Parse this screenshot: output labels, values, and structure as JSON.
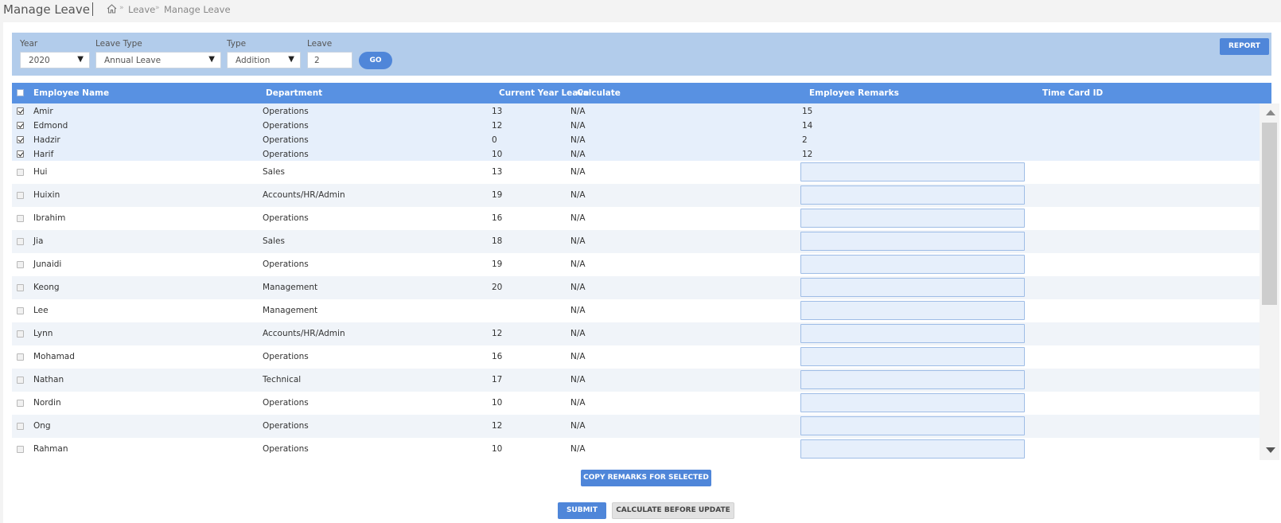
{
  "page": {
    "title": "Manage Leave"
  },
  "breadcrumb": {
    "home_icon": "home-icon",
    "items": [
      "Leave",
      "Manage Leave"
    ],
    "separator": "»"
  },
  "filters": {
    "year": {
      "label": "Year",
      "value": "2020"
    },
    "leave_type": {
      "label": "Leave Type",
      "value": "Annual Leave"
    },
    "type": {
      "label": "Type",
      "value": "Addition"
    },
    "leave": {
      "label": "Leave",
      "value": "2"
    },
    "go_label": "GO",
    "report_label": "REPORT"
  },
  "table": {
    "columns": [
      "Employee Name",
      "Department",
      "Current Year Leave",
      "Calculate",
      "Employee Remarks",
      "Time Card ID"
    ],
    "rows": [
      {
        "name": "Amir",
        "department": "Operations",
        "current_year_leave": "13",
        "calculate": "N/A",
        "remarks": "15",
        "checked": true
      },
      {
        "name": "Edmond",
        "department": "Operations",
        "current_year_leave": "12",
        "calculate": "N/A",
        "remarks": "14",
        "checked": true
      },
      {
        "name": "Hadzir",
        "department": "Operations",
        "current_year_leave": "0",
        "calculate": "N/A",
        "remarks": "2",
        "checked": true
      },
      {
        "name": "Harif",
        "department": "Operations",
        "current_year_leave": "10",
        "calculate": "N/A",
        "remarks": "12",
        "checked": true
      },
      {
        "name": "Hui",
        "department": "Sales",
        "current_year_leave": "13",
        "calculate": "N/A",
        "remarks": "",
        "checked": false
      },
      {
        "name": "Huixin",
        "department": "Accounts/HR/Admin",
        "current_year_leave": "19",
        "calculate": "N/A",
        "remarks": "",
        "checked": false
      },
      {
        "name": "Ibrahim",
        "department": "Operations",
        "current_year_leave": "16",
        "calculate": "N/A",
        "remarks": "",
        "checked": false
      },
      {
        "name": "Jia",
        "department": "Sales",
        "current_year_leave": "18",
        "calculate": "N/A",
        "remarks": "",
        "checked": false
      },
      {
        "name": "Junaidi",
        "department": "Operations",
        "current_year_leave": "19",
        "calculate": "N/A",
        "remarks": "",
        "checked": false
      },
      {
        "name": "Keong",
        "department": "Management",
        "current_year_leave": "20",
        "calculate": "N/A",
        "remarks": "",
        "checked": false
      },
      {
        "name": "Lee",
        "department": "Management",
        "current_year_leave": "",
        "calculate": "N/A",
        "remarks": "",
        "checked": false
      },
      {
        "name": "Lynn",
        "department": "Accounts/HR/Admin",
        "current_year_leave": "12",
        "calculate": "N/A",
        "remarks": "",
        "checked": false
      },
      {
        "name": "Mohamad",
        "department": "Operations",
        "current_year_leave": "16",
        "calculate": "N/A",
        "remarks": "",
        "checked": false
      },
      {
        "name": "Nathan",
        "department": "Technical",
        "current_year_leave": "17",
        "calculate": "N/A",
        "remarks": "",
        "checked": false
      },
      {
        "name": "Nordin",
        "department": "Operations",
        "current_year_leave": "10",
        "calculate": "N/A",
        "remarks": "",
        "checked": false
      },
      {
        "name": "Ong",
        "department": "Operations",
        "current_year_leave": "12",
        "calculate": "N/A",
        "remarks": "",
        "checked": false
      },
      {
        "name": "Rahman",
        "department": "Operations",
        "current_year_leave": "10",
        "calculate": "N/A",
        "remarks": "",
        "checked": false
      }
    ]
  },
  "actions": {
    "copy_remarks": "COPY REMARKS FOR SELECTED",
    "submit": "SUBMIT",
    "calculate_before_update": "CALCULATE BEFORE UPDATE"
  },
  "colors": {
    "accent": "#4f86d9",
    "header_bg": "#5891e2",
    "filter_bg": "#b2cceb",
    "selected_row_bg": "#e6effb",
    "alt_row_bg": "#f0f4f9"
  }
}
